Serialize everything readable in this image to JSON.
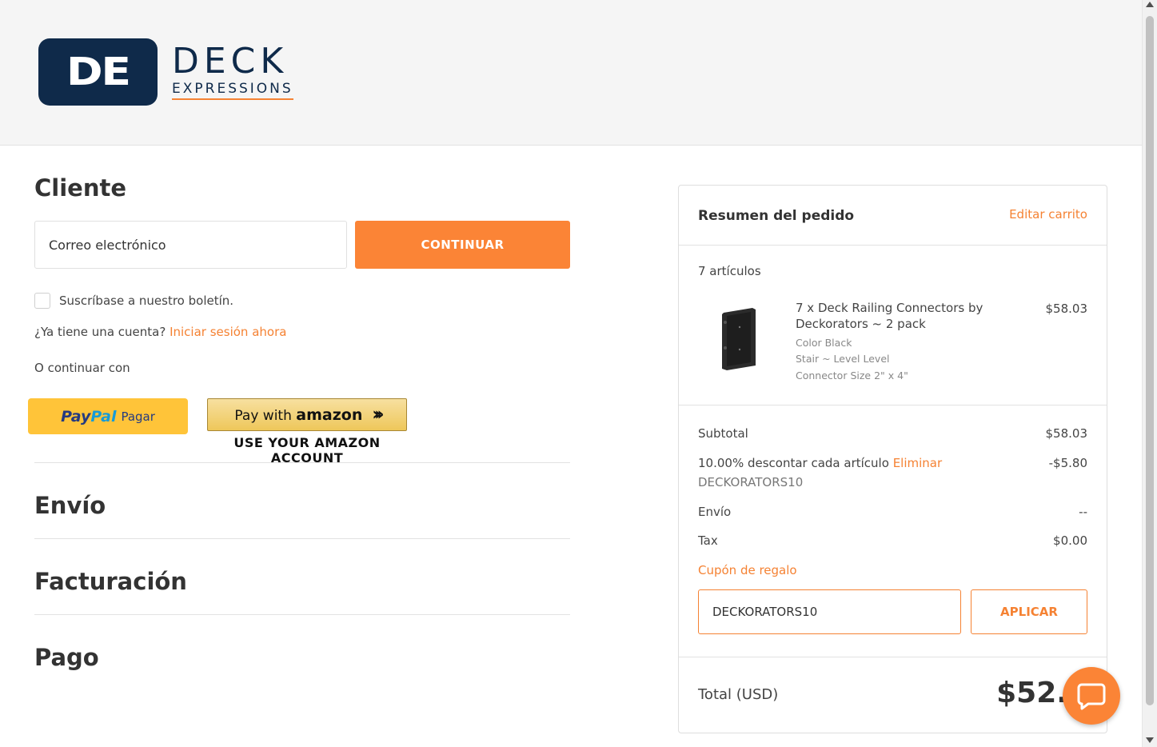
{
  "brand": {
    "mark": "DE",
    "name_line1": "DECK",
    "name_line2": "EXPRESSIONS"
  },
  "customer": {
    "title": "Cliente",
    "email_placeholder": "Correo electrónico",
    "continue_label": "CONTINUAR",
    "newsletter_label": "Suscríbase a nuestro boletín.",
    "account_question": "¿Ya tiene una cuenta?",
    "signin_link": "Iniciar sesión ahora",
    "continue_with": "O continuar con"
  },
  "payment_buttons": {
    "paypal_pay": "Pay",
    "paypal_pal": "Pal",
    "paypal_label": "Pagar",
    "amazon_prefix": "Pay with",
    "amazon_brand": "amazon",
    "amazon_sub": "USE YOUR AMAZON ACCOUNT"
  },
  "sections": {
    "shipping": "Envío",
    "billing": "Facturación",
    "payment": "Pago"
  },
  "summary": {
    "title": "Resumen del pedido",
    "edit_cart": "Editar carrito",
    "items_count": "7 artículos",
    "product": {
      "name": "7 x Deck Railing Connectors by Deckorators ~ 2 pack",
      "price": "$58.03",
      "options": [
        "Color Black",
        "Stair ~ Level Level",
        "Connector Size 2\" x 4\""
      ]
    },
    "subtotal_label": "Subtotal",
    "subtotal_value": "$58.03",
    "discount_label": "10.00% descontar cada artículo",
    "discount_remove": "Eliminar",
    "discount_value": "-$5.80",
    "discount_code": "DECKORATORS10",
    "shipping_label": "Envío",
    "shipping_value": "--",
    "tax_label": "Tax",
    "tax_value": "$0.00",
    "gift_link": "Cupón de regalo",
    "coupon_input_value": "DECKORATORS10",
    "apply_label": "APLICAR",
    "total_label": "Total (USD)",
    "total_value": "$52.2"
  },
  "colors": {
    "accent": "#fb8436",
    "brand_navy": "#0f2a4a"
  },
  "icons": {
    "chat": "chat-bubble-icon",
    "paypal": "paypal-logo",
    "amazon_arrow": "double-chevron-right-icon"
  }
}
